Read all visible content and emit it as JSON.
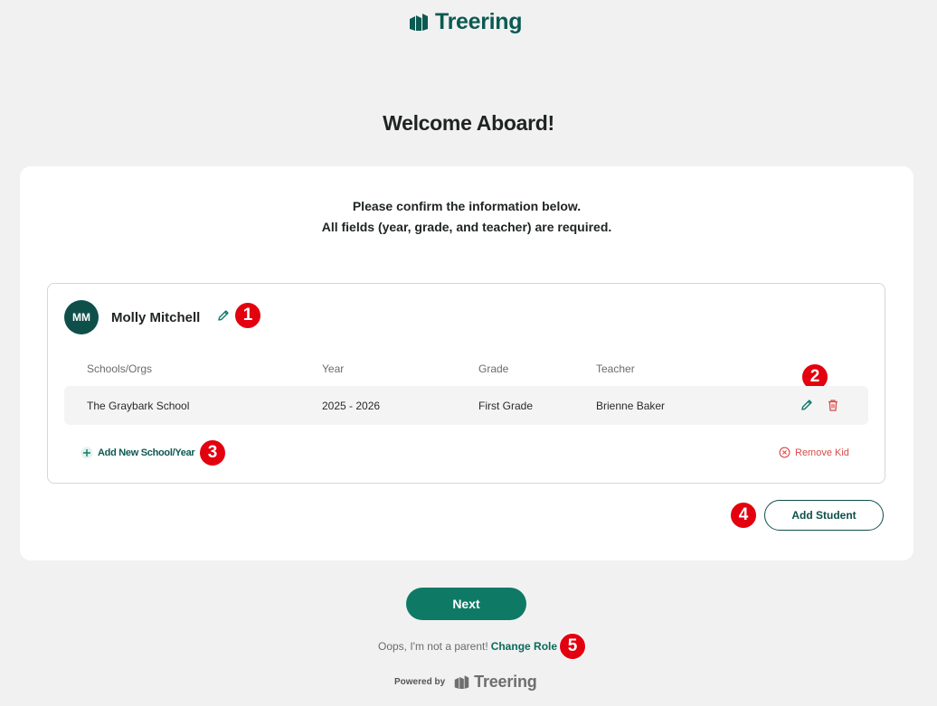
{
  "brand": {
    "name": "Treering",
    "icon": "treering-logo-icon",
    "color": "#0b5a52",
    "accent": "#0e7a66",
    "danger": "#d94b4b",
    "annotation": "#e3000f"
  },
  "page": {
    "title": "Welcome Aboard!",
    "instructions_line1": "Please confirm the information below.",
    "instructions_line2": "All fields (year, grade, and teacher) are required."
  },
  "kid": {
    "initials": "MM",
    "name": "Molly Mitchell",
    "edit_icon": "pencil-icon"
  },
  "table": {
    "headers": [
      "Schools/Orgs",
      "Year",
      "Grade",
      "Teacher"
    ],
    "rows": [
      {
        "school": "The Graybark School",
        "year": "2025 - 2026",
        "grade": "First Grade",
        "teacher": "Brienne Baker",
        "edit_icon": "pencil-icon",
        "delete_icon": "trash-icon"
      }
    ]
  },
  "actions": {
    "add_school": "Add New School/Year",
    "add_school_icon": "plus-icon",
    "remove_kid": "Remove Kid",
    "remove_kid_icon": "circle-x-icon",
    "add_student": "Add Student",
    "next": "Next"
  },
  "footer": {
    "oops_text": "Oops, I'm not a parent!",
    "change_role": "Change Role",
    "powered_by": "Powered by",
    "powered_logo": "Treering"
  },
  "annotations": [
    "1",
    "2",
    "3",
    "4",
    "5"
  ]
}
